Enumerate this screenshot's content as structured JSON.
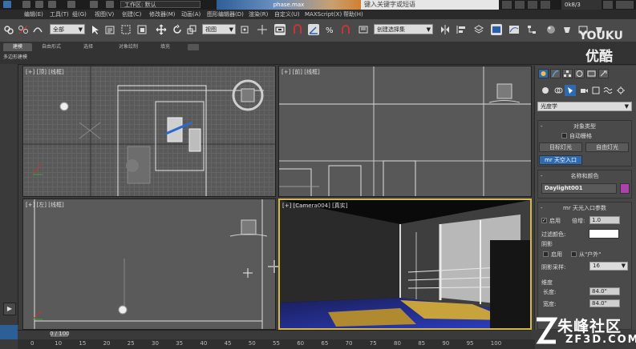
{
  "titlebar": {
    "workspace": "工作区: 默认",
    "doc_title": "phase.max",
    "search_placeholder": "键入关键字或短语",
    "user": "0k8/3"
  },
  "menu": [
    "编辑(E)",
    "工具(T)",
    "组(G)",
    "视图(V)",
    "创建(C)",
    "修改器(M)",
    "动画(A)",
    "图形编辑器(D)",
    "渲染(R)",
    "自定义(U)",
    "MAXScript(X)",
    "帮助(H)"
  ],
  "toolbar": {
    "selection_filter": "全部",
    "ref_coord": "视图",
    "named_selection": "创建选择集"
  },
  "ribbon": {
    "tabs": [
      "建模",
      "自由形式",
      "选择",
      "对象绘制",
      "填充"
    ],
    "active_tab": "建模",
    "sub_label": "多边形建模"
  },
  "viewports": {
    "top": "[+] [顶] [线框]",
    "front": "[+] [前] [线框]",
    "left": "[+] [左] [线框]",
    "camera": "[+] [Camera004] [真实]"
  },
  "command_panel": {
    "category": "光度学",
    "object_type": {
      "title": "对象类型",
      "autogrid": "自动栅格",
      "buttons": [
        "目标灯光",
        "自由灯光",
        "mr 天空入口"
      ]
    },
    "name_color": {
      "title": "名称和颜色",
      "name": "Daylight001",
      "color": "#b040b0"
    },
    "skyportal": {
      "title": "mr 天光入口参数",
      "on_label": "启用",
      "multiplier_label": "倍增:",
      "multiplier": "1.0",
      "filter_label": "过滤颜色:",
      "filter_color": "#ffffff",
      "shadows_title": "阴影",
      "shadow_on": "启用",
      "from_outdoors": "从\"户外\"",
      "shadow_samples_label": "阴影采样:",
      "shadow_samples": "16",
      "dimensions_title": "维度",
      "length_label": "长度:",
      "length": "84.0\"",
      "width_label": "宽度:",
      "width": "84.0\""
    }
  },
  "timeline": {
    "frame": "0 / 100",
    "ticks": [
      "0",
      "10",
      "15",
      "20",
      "25",
      "30",
      "35",
      "40",
      "45",
      "50",
      "55",
      "60",
      "65",
      "70",
      "75",
      "80",
      "85",
      "90",
      "95",
      "100"
    ]
  },
  "watermarks": {
    "youku_en": "YOUKU",
    "youku_cn": "优酷",
    "zf_cn": "朱峰社区",
    "zf_en": "ZF3D.COM"
  }
}
